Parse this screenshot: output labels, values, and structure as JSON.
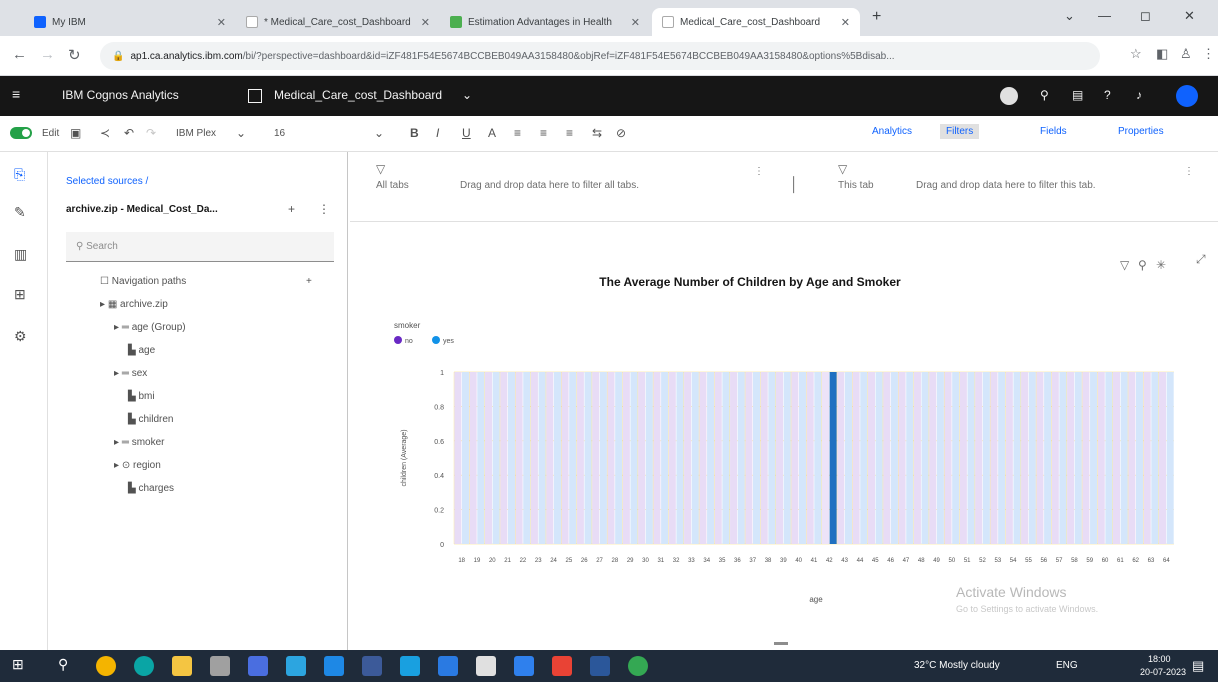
{
  "browser": {
    "tabs": [
      {
        "label": "My IBM",
        "color": "#0f62fe"
      },
      {
        "label": "* Medical_Care_cost_Dashboard",
        "color": "#ffffff"
      },
      {
        "label": "Estimation Advantages in Health",
        "color": "#4caf50"
      },
      {
        "label": "Medical_Care_cost_Dashboard",
        "color": "#ffffff"
      }
    ],
    "new_tab": "+",
    "url_host": "ap1.ca.analytics.ibm.com",
    "url_rest": "/bi/?perspective=dashboard&id=iZF481F54E5674BCCBEB049AA3158480&objRef=iZF481F54E5674BCCBEB049AA3158480&options%5Bdisab...",
    "window_controls": [
      "⌄",
      "—",
      "◻",
      "✕"
    ]
  },
  "header": {
    "app_name": "IBM Cognos Analytics",
    "dashboard_name": "Medical_Care_cost_Dashboard"
  },
  "toolbar": {
    "edit_label": "Edit",
    "font_name": "IBM Plex",
    "font_size": "16",
    "analytics_label": "Analytics",
    "filters_label": "Filters",
    "fields_label": "Fields",
    "properties_label": "Properties"
  },
  "sources": {
    "heading": "Selected sources /",
    "source_name": "archive.zip - Medical_Cost_Da...",
    "search_placeholder": "Search",
    "tree": [
      {
        "label": "Navigation paths",
        "indent": 0,
        "icon": "folder-icon"
      },
      {
        "label": "archive.zip",
        "indent": 0,
        "icon": "table-icon"
      },
      {
        "label": "age (Group)",
        "indent": 1,
        "icon": "group-icon"
      },
      {
        "label": "age",
        "indent": 2,
        "icon": "measure-icon"
      },
      {
        "label": "sex",
        "indent": 1,
        "icon": "group-icon"
      },
      {
        "label": "bmi",
        "indent": 2,
        "icon": "measure-icon"
      },
      {
        "label": "children",
        "indent": 2,
        "icon": "measure-icon"
      },
      {
        "label": "smoker",
        "indent": 1,
        "icon": "group-icon"
      },
      {
        "label": "region",
        "indent": 1,
        "icon": "location-icon"
      },
      {
        "label": "charges",
        "indent": 2,
        "icon": "measure-icon"
      }
    ]
  },
  "filters": {
    "all_tabs_label": "All tabs",
    "all_tabs_hint": "Drag and drop data here to filter all tabs.",
    "this_tab_label": "This tab",
    "this_tab_hint": "Drag and drop data here to filter this tab."
  },
  "chart_data": {
    "type": "bar",
    "title": "The Average Number of Children by Age and Smoker",
    "xlabel": "age",
    "ylabel": "children (Average)",
    "legend_title": "smoker",
    "ylim": [
      0,
      1
    ],
    "yticks": [
      "0",
      "0.2",
      "0.4",
      "0.6",
      "0.8",
      "1"
    ],
    "categories": [
      "18",
      "19",
      "20",
      "21",
      "22",
      "23",
      "24",
      "25",
      "26",
      "27",
      "28",
      "29",
      "30",
      "31",
      "32",
      "33",
      "34",
      "35",
      "36",
      "37",
      "38",
      "39",
      "40",
      "41",
      "42",
      "43",
      "44",
      "45",
      "46",
      "47",
      "48",
      "49",
      "50",
      "51",
      "52",
      "53",
      "54",
      "55",
      "56",
      "57",
      "58",
      "59",
      "60",
      "61",
      "62",
      "63",
      "64"
    ],
    "series": [
      {
        "name": "no",
        "color": "#6929c4",
        "values": [
          1,
          1,
          1,
          1,
          1,
          1,
          1,
          1,
          1,
          1,
          1,
          1,
          1,
          1,
          1,
          1,
          1,
          1,
          1,
          1,
          1,
          1,
          1,
          1,
          1,
          1,
          1,
          1,
          1,
          1,
          1,
          1,
          1,
          1,
          1,
          1,
          1,
          1,
          1,
          1,
          1,
          1,
          1,
          1,
          1,
          1,
          1
        ]
      },
      {
        "name": "yes",
        "color": "#1192e8",
        "values": [
          1,
          1,
          1,
          1,
          1,
          1,
          1,
          1,
          1,
          1,
          1,
          1,
          1,
          1,
          1,
          1,
          1,
          1,
          1,
          1,
          1,
          1,
          1,
          1,
          1,
          1,
          1,
          1,
          1,
          1,
          1,
          1,
          1,
          1,
          1,
          1,
          1,
          1,
          1,
          1,
          1,
          1,
          1,
          1,
          1,
          1,
          1
        ]
      }
    ],
    "highlighted_category": "42",
    "legend_placement": "top-left"
  },
  "watermark": {
    "line1": "Activate Windows",
    "line2": "Go to Settings to activate Windows."
  },
  "taskbar": {
    "weather": "32°C  Mostly cloudy",
    "lang": "ENG",
    "time": "18:00",
    "date": "20-07-2023"
  }
}
